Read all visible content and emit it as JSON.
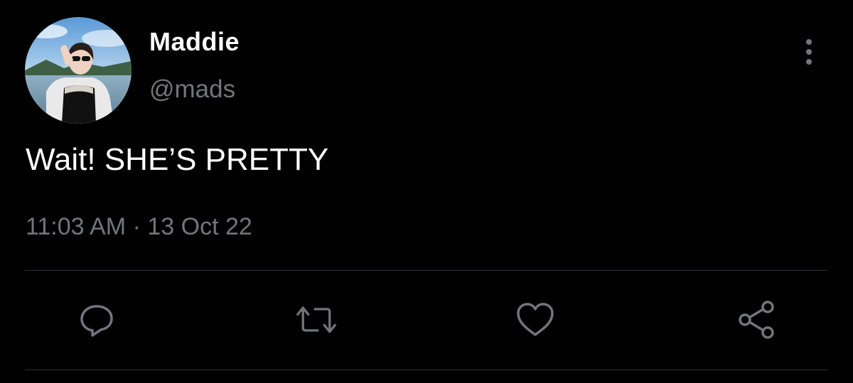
{
  "tweet": {
    "display_name": "Maddie",
    "handle": "@mads",
    "text": "Wait! SHE’S PRETTY",
    "time": "11:03 AM",
    "separator": "·",
    "date": "13 Oct 22"
  },
  "icons": {
    "more": "more-vertical-icon",
    "reply": "reply-icon",
    "retweet": "retweet-icon",
    "like": "like-icon",
    "share": "share-icon"
  },
  "colors": {
    "background": "#000000",
    "primary_text": "#ffffff",
    "secondary_text": "#71767b",
    "divider": "#2f3336"
  }
}
